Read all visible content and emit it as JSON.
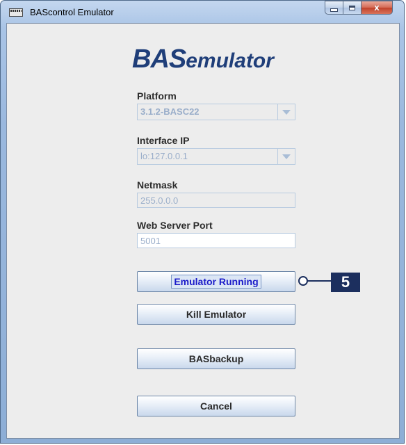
{
  "window": {
    "title": "BAScontrol Emulator",
    "close_glyph": "x"
  },
  "logo": {
    "bold": "BAS",
    "rest": "emulator"
  },
  "fields": {
    "platform": {
      "label": "Platform",
      "value": "3.1.2-BASC22"
    },
    "interface_ip": {
      "label": "Interface IP",
      "value": "lo:127.0.0.1"
    },
    "netmask": {
      "label": "Netmask",
      "value": "255.0.0.0"
    },
    "web_server_port": {
      "label": "Web Server Port",
      "value": "5001"
    }
  },
  "buttons": {
    "emulator_running": "Emulator Running",
    "kill_emulator": "Kill Emulator",
    "basbackup": "BASbackup",
    "cancel": "Cancel"
  },
  "callout": {
    "number": "5"
  },
  "icons": {
    "app": "app-window-icon",
    "minimize": "minimize-icon",
    "maximize": "maximize-icon",
    "close": "close-icon",
    "dropdown": "chevron-down-icon"
  },
  "colors": {
    "logo": "#1f3e79",
    "callout": "#1c2f5e",
    "running_text": "#1c1cc9"
  }
}
